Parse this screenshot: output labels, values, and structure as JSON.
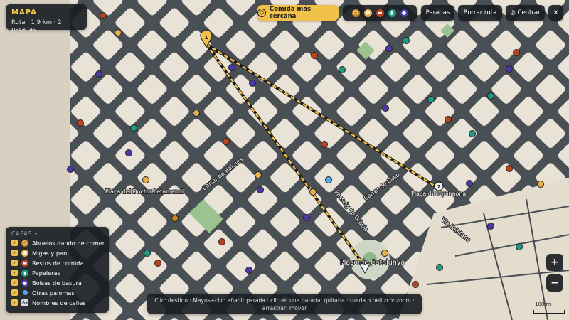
{
  "header": {
    "title": "MAPA",
    "route_summary": "Ruta · 1,9 km · 2 paradas"
  },
  "toolbar": {
    "nearest_label": "Comida más cercana",
    "stops_label": "Paradas",
    "clear_label": "Borrar ruta",
    "center_label": "◎ Centrar",
    "close_label": "✕",
    "filters": [
      {
        "icon": "old-man-feeding-icon",
        "color": "#c8841e"
      },
      {
        "icon": "bread-crumbs-icon",
        "color": "#e3b04b"
      },
      {
        "icon": "food-scraps-icon",
        "color": "#b8431f"
      },
      {
        "icon": "trash-bin-icon",
        "color": "#1e9b82"
      },
      {
        "icon": "garbage-bag-icon",
        "color": "#4b3aa6"
      }
    ]
  },
  "layers": {
    "header": "CAPAS ▾",
    "items": [
      {
        "label": "Abuelos dando de comer",
        "icon": "old-man-feeding-icon",
        "color": "#c8841e",
        "checked": true
      },
      {
        "label": "Migas y pan",
        "icon": "bread-crumbs-icon",
        "color": "#e3b04b",
        "checked": true
      },
      {
        "label": "Restos de comida",
        "icon": "food-scraps-icon",
        "color": "#b8431f",
        "checked": true
      },
      {
        "label": "Papeleras",
        "icon": "trash-bin-icon",
        "color": "#1e9b82",
        "checked": true
      },
      {
        "label": "Bolsas de basura",
        "icon": "garbage-bag-icon",
        "color": "#4b3aa6",
        "checked": true
      },
      {
        "label": "Otras palomas",
        "icon": "pigeon-icon",
        "color": "#5aa7e0",
        "checked": true
      },
      {
        "label": "Nombres de calles",
        "icon": "text-label-icon",
        "color": "#e0e0e0",
        "checked": true
      }
    ]
  },
  "map": {
    "labels": [
      {
        "text": "Plaça del Doctor Letamendi"
      },
      {
        "text": "Carrer de Balmes"
      },
      {
        "text": "Passeig de Gràcia"
      },
      {
        "text": "Carrer de Casp"
      },
      {
        "text": "Plaça d'Urquinaona"
      },
      {
        "text": "Via Laietana"
      },
      {
        "text": "Plaça de Catalunya"
      }
    ],
    "stop_markers": [
      "1",
      "2"
    ],
    "colors": {
      "route": "#f2c14a",
      "block": "#e9e2d6",
      "street": "#4a4f55",
      "tree": "#2f6b3a"
    }
  },
  "hint": "Clic: destino · Mayús+clic: añadir parada · clic en una parada: quitarla · rueda o pellizco: zoom · arrastrar: mover",
  "zoom": {
    "in_label": "+",
    "out_label": "−"
  },
  "scale": {
    "label": "100 m"
  }
}
